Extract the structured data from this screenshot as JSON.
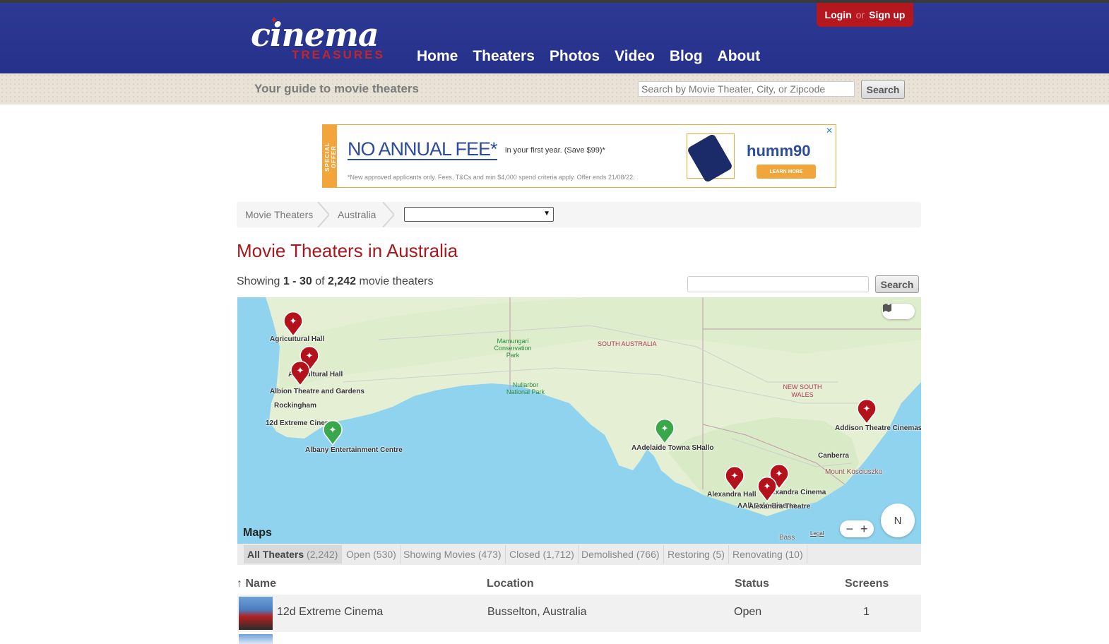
{
  "header": {
    "logo_main": "cinema",
    "logo_sub": "TREASURES",
    "nav": [
      "Home",
      "Theaters",
      "Photos",
      "Video",
      "Blog",
      "About"
    ],
    "login": "Login",
    "or": "or",
    "signup": "Sign up",
    "tagline": "Your guide to movie theaters",
    "search_placeholder": "Search by Movie Theater, City, or Zipcode",
    "search_button": "Search"
  },
  "ad": {
    "strip": "SPECIAL OFFER",
    "headline": "NO ANNUAL FEE*",
    "sub": "in your first year. (Save $99)*",
    "fine": "*New approved applicants only. Fees, T&Cs and min $4,000 spend criteria apply. Offer ends 21/08/22.",
    "brand": "humm90",
    "cta": "LEARN MORE",
    "close": "✕"
  },
  "breadcrumb": [
    "Movie Theaters",
    "Australia"
  ],
  "page": {
    "title": "Movie Theaters in Australia",
    "showing_prefix": "Showing",
    "showing_range": "1 - 30",
    "showing_of": "of",
    "showing_total": "2,242",
    "showing_suffix": "movie theaters",
    "search_button": "Search"
  },
  "map": {
    "brand": "Maps",
    "legal": "Legal",
    "compass": "N",
    "zoom_out": "−",
    "zoom_in": "+",
    "regions": [
      "SOUTH AUSTRALIA",
      "NEW SOUTH WALES"
    ],
    "parks": [
      "Mamungari Conservation Park",
      "Nullarbor National Park"
    ],
    "places": [
      "Canberra",
      "Mount Kosciuszko",
      "Bass"
    ],
    "pin_labels": [
      "Agricultural Hall",
      "Agricultural Hall",
      "Albion Theatre and Gardens",
      "Rockingham",
      "12d Extreme Cinema",
      "Albany Entertainment Centre",
      "AAdelaide Towna SHallo",
      "Addison Theatre Cinemas",
      "Alexandra Hall",
      "Alexandra Cinema",
      "AAll Galo Cinema",
      "Alexandra Theatre"
    ]
  },
  "filters": [
    {
      "label": "All Theaters",
      "count": "(2,242)"
    },
    {
      "label": "Open",
      "count": "(530)"
    },
    {
      "label": "Showing Movies",
      "count": "(473)"
    },
    {
      "label": "Closed",
      "count": "(1,712)"
    },
    {
      "label": "Demolished",
      "count": "(766)"
    },
    {
      "label": "Restoring",
      "count": "(5)"
    },
    {
      "label": "Renovating",
      "count": "(10)"
    }
  ],
  "table": {
    "sort_arrow": "↑",
    "headers": [
      "Name",
      "Location",
      "Status",
      "Screens"
    ],
    "rows": [
      {
        "name": "12d Extreme Cinema",
        "location": "Busselton, Australia",
        "status": "Open",
        "screens": "1"
      }
    ]
  },
  "colors": {
    "header_blue": "#27348b",
    "brand_red": "#a51a20",
    "pin_red": "#b3121c",
    "pin_green": "#3aa84a"
  }
}
